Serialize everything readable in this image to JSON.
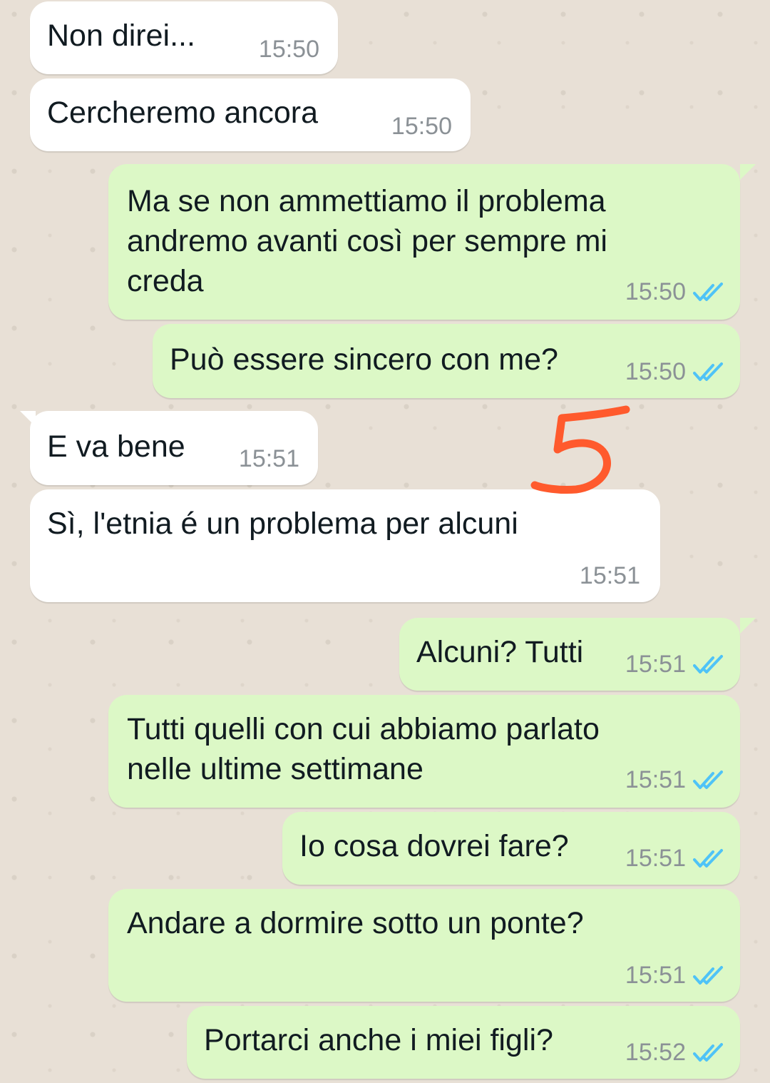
{
  "messages": [
    {
      "direction": "incoming",
      "text": "Non direi...",
      "time": "15:50"
    },
    {
      "direction": "incoming",
      "text": "Cercheremo ancora",
      "time": "15:50"
    },
    {
      "direction": "outgoing",
      "lines": [
        "Ma se non ammettiamo il problema",
        "andremo avanti così per sempre mi",
        "creda"
      ],
      "time": "15:50",
      "status": "read"
    },
    {
      "direction": "outgoing",
      "text": "Può essere sincero con me?",
      "time": "15:50",
      "status": "read"
    },
    {
      "direction": "incoming",
      "text": "E va bene",
      "time": "15:51"
    },
    {
      "direction": "incoming",
      "text": "Sì, l'etnia é un problema per alcuni",
      "time": "15:51"
    },
    {
      "direction": "outgoing",
      "text": "Alcuni? Tutti",
      "time": "15:51",
      "status": "read"
    },
    {
      "direction": "outgoing",
      "lines": [
        "Tutti quelli con cui abbiamo parlato",
        "nelle ultime settimane"
      ],
      "time": "15:51",
      "status": "read"
    },
    {
      "direction": "outgoing",
      "text": "Io cosa dovrei fare?",
      "time": "15:51",
      "status": "read"
    },
    {
      "direction": "outgoing",
      "text": "Andare a dormire sotto un ponte?",
      "time": "15:51",
      "status": "read"
    },
    {
      "direction": "outgoing",
      "text": "Portarci anche i miei figli?",
      "time": "15:52",
      "status": "read"
    }
  ],
  "annotation": {
    "text": "5",
    "color": "#FF5A2D"
  },
  "colors": {
    "incoming_bubble": "#FFFFFF",
    "outgoing_bubble": "#DCF8C6",
    "read_ticks": "#4FC3F7",
    "timestamp": "#8B9196"
  },
  "icons": {
    "read_status": "double-check-icon"
  }
}
